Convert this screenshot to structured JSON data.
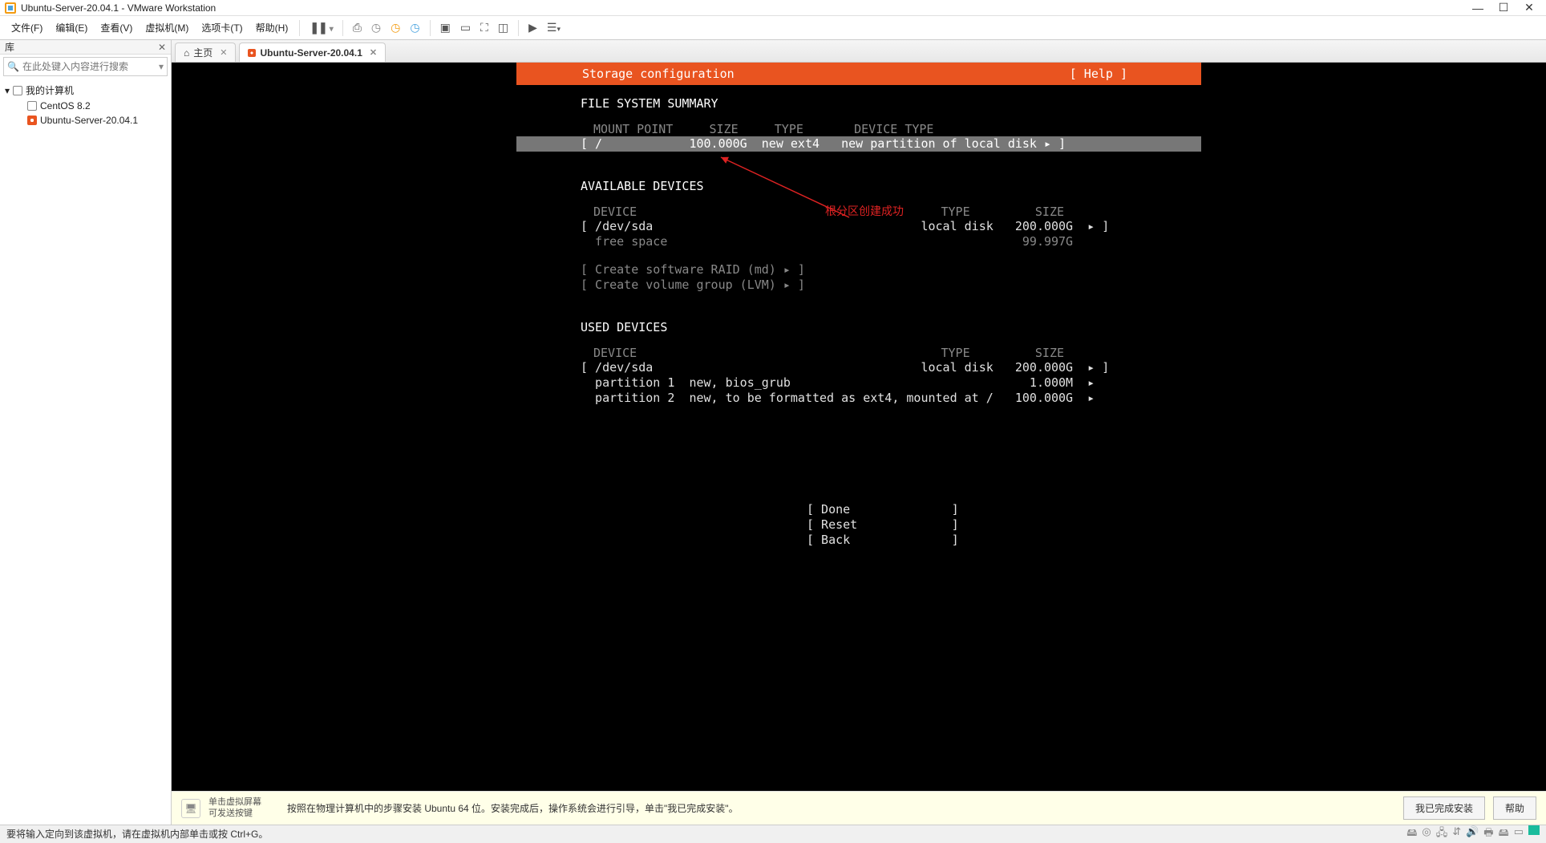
{
  "window": {
    "title": "Ubuntu-Server-20.04.1 - VMware Workstation"
  },
  "menu": {
    "items": [
      "文件(F)",
      "编辑(E)",
      "查看(V)",
      "虚拟机(M)",
      "选项卡(T)",
      "帮助(H)"
    ]
  },
  "sidebar": {
    "library_label": "库",
    "search_placeholder": "在此处键入内容进行搜索",
    "root": "我的计算机",
    "children": [
      "CentOS 8.2",
      "Ubuntu-Server-20.04.1"
    ]
  },
  "tabs": {
    "home": "主页",
    "vm": "Ubuntu-Server-20.04.1"
  },
  "installer": {
    "title": "Storage configuration",
    "help": "[ Help ]",
    "fs_summary": "FILE SYSTEM SUMMARY",
    "fs_headers": "MOUNT POINT     SIZE     TYPE       DEVICE TYPE",
    "fs_row": "[ /            100.000G  new ext4   new partition of local disk ▸ ]",
    "avail": "AVAILABLE DEVICES",
    "avail_hdr": "DEVICE                                          TYPE         SIZE",
    "avail_r1": "[ /dev/sda                                     local disk   200.000G  ▸ ]",
    "avail_r2": "  free space                                                 99.997G",
    "raid": "[ Create software RAID (md) ▸ ]",
    "lvm": "[ Create volume group (LVM) ▸ ]",
    "used": "USED DEVICES",
    "used_hdr": "DEVICE                                          TYPE         SIZE",
    "used_r1": "[ /dev/sda                                     local disk   200.000G  ▸ ]",
    "used_r2": "  partition 1  new, bios_grub                                 1.000M  ▸",
    "used_r3": "  partition 2  new, to be formatted as ext4, mounted at /   100.000G  ▸",
    "btn_done": "[ Done              ]",
    "btn_reset": "[ Reset             ]",
    "btn_back": "[ Back              ]"
  },
  "annotation": "根分区创建成功",
  "info": {
    "hint": "单击虚拟屏幕\n可发送按键",
    "text": "按照在物理计算机中的步骤安装 Ubuntu 64 位。安装完成后，操作系统会进行引导，单击\"我已完成安装\"。",
    "btn_done": "我已完成安装",
    "btn_help": "帮助"
  },
  "status": "要将输入定向到该虚拟机，请在虚拟机内部单击或按 Ctrl+G。"
}
